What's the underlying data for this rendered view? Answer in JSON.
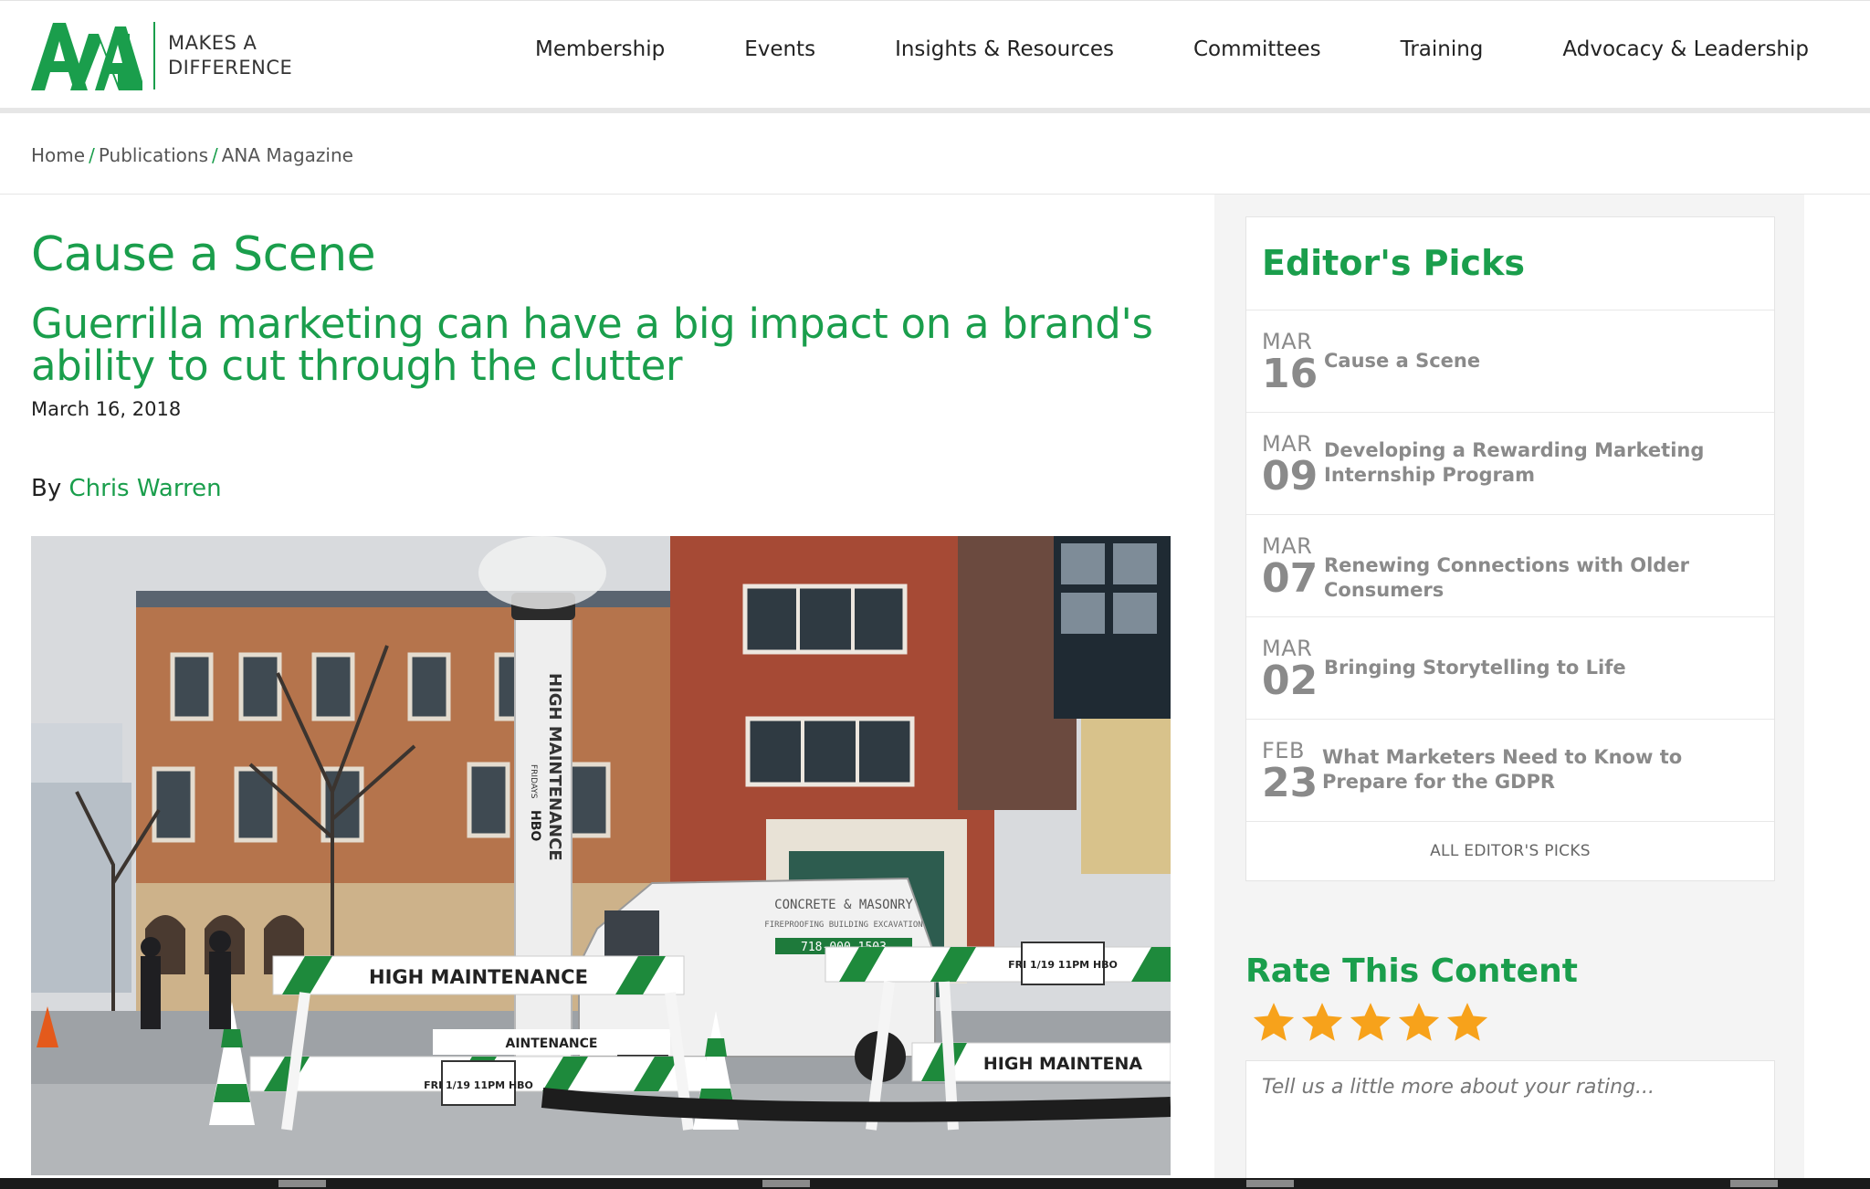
{
  "header": {
    "logo_letters": "ANA",
    "logo_tagline_line1": "MAKES A",
    "logo_tagline_line2": "DIFFERENCE",
    "nav": [
      "Membership",
      "Events",
      "Insights & Resources",
      "Committees",
      "Training",
      "Advocacy & Leadership"
    ]
  },
  "breadcrumb": {
    "items": [
      "Home",
      "Publications",
      "ANA Magazine"
    ],
    "separator": "/"
  },
  "article": {
    "title": "Cause a Scene",
    "subtitle": "Guerrilla marketing can have a big impact on a brand's ability to cut through the clutter",
    "date": "March 16, 2018",
    "by_label": "By",
    "author": "Chris Warren",
    "hero_signs": {
      "pole_text": "HIGH MAINTENANCE",
      "pole_sub": "FRIDAYS",
      "pole_brand": "HBO",
      "barrier_text": "HIGH MAINTENANCE",
      "barrier_text_partial": "AINTENANCE",
      "barrier_text_right": "HIGH MAINTENA",
      "sign_small": "FRI 1/19 11PM HBO",
      "sign_right": "FRI 1/19 11PM HBO",
      "van_line1": "CONCRETE & MASONRY",
      "van_line2": "FIREPROOFING BUILDING EXCAVATION",
      "van_phone": "718-000-1503"
    }
  },
  "sidebar": {
    "editors_picks_title": "Editor's Picks",
    "picks": [
      {
        "month": "MAR",
        "day": "16",
        "title": "Cause a Scene"
      },
      {
        "month": "MAR",
        "day": "09",
        "title": "Developing a Rewarding Marketing Internship Program"
      },
      {
        "month": "MAR",
        "day": "07",
        "title": "Renewing Connections with Older Consumers"
      },
      {
        "month": "MAR",
        "day": "02",
        "title": "Bringing Storytelling to Life"
      },
      {
        "month": "FEB",
        "day": "23",
        "title": "What Marketers Need to Know to Prepare for the GDPR"
      }
    ],
    "all_picks_label": "ALL EDITOR'S PICKS",
    "rate_title": "Rate This Content",
    "rating_stars": 5,
    "rating_max": 5,
    "rating_placeholder": "Tell us a little more about your rating..."
  },
  "colors": {
    "brand_green": "#1a9e4c",
    "star_orange": "#f7a21b",
    "muted_gray": "#8a8a8a"
  }
}
